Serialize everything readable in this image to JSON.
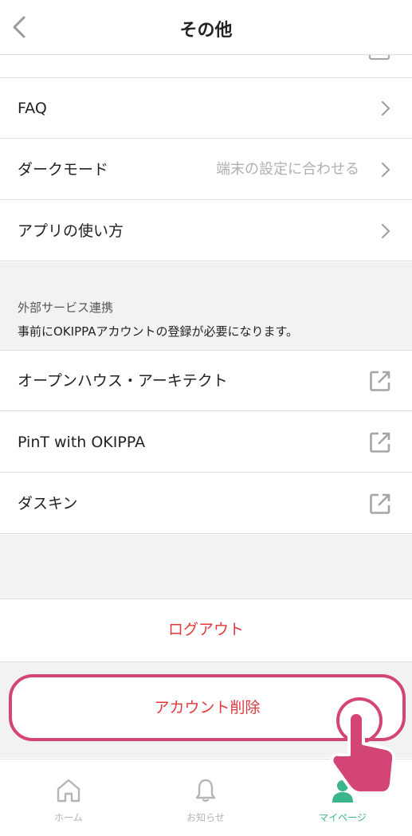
{
  "header": {
    "title": "その他"
  },
  "menu": [
    {
      "label": "FAQ",
      "value": ""
    },
    {
      "label": "ダークモード",
      "value": "端末の設定に合わせる"
    },
    {
      "label": "アプリの使い方",
      "value": ""
    }
  ],
  "external": {
    "title": "外部サービス連携",
    "description": "事前にOKIPPAアカウントの登録が必要になります。",
    "items": [
      {
        "label": "オープンハウス・アーキテクト"
      },
      {
        "label": "PinT with OKIPPA"
      },
      {
        "label": "ダスキン"
      }
    ]
  },
  "actions": {
    "logout": "ログアウト",
    "delete_account": "アカウント削除"
  },
  "tabs": [
    {
      "label": "ホーム",
      "icon": "home-icon"
    },
    {
      "label": "お知らせ",
      "icon": "bell-icon"
    },
    {
      "label": "マイページ",
      "icon": "person-icon",
      "active": true
    }
  ],
  "colors": {
    "accent_red": "#e0393e",
    "highlight_pink": "#d44577",
    "active_tab_green": "#3bb58a"
  }
}
